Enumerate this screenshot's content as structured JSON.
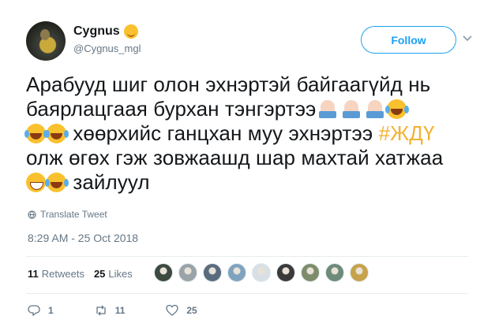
{
  "author": {
    "display_name": "Cygnus",
    "handle": "@Cygnus_mgl",
    "name_emoji": "smiling-face-with-smiling-eyes"
  },
  "follow_label": "Follow",
  "tweet": {
    "line1": "Арабууд шиг олон эхнэртэй байгаагүйд нь",
    "line2": "баярлацгаая бурхан тэнгэртээ",
    "line3_text": " хөөрхийс ганцхан муу эхнэртээ ",
    "hashtag": "#ЖДҮ",
    "line4": "олж өгөх гэж зовжаашд шар махтай хатжаа",
    "line5_text": " зайлуул"
  },
  "translate_label": "Translate Tweet",
  "timestamp": "8:29 AM - 25 Oct 2018",
  "stats": {
    "retweets_count": "11",
    "retweets_label": "Retweets",
    "likes_count": "25",
    "likes_label": "Likes"
  },
  "likers": [
    "#3c4a3f",
    "#9aa4a8",
    "#5a6b7d",
    "#7fa3bf",
    "#d8e0e6",
    "#3a3a3a",
    "#7d8c6a",
    "#6e8a7a",
    "#c6a24a"
  ],
  "actions": {
    "reply_count": "1",
    "retweet_count": "11",
    "like_count": "25"
  },
  "colors": {
    "accent": "#1da1f2",
    "hashtag": "#f2b233",
    "secondary_text": "#657786"
  }
}
